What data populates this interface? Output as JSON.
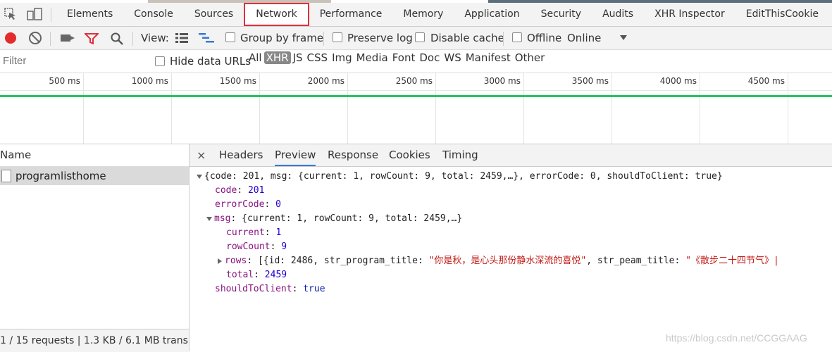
{
  "tabs": [
    "Elements",
    "Console",
    "Sources",
    "Network",
    "Performance",
    "Memory",
    "Application",
    "Security",
    "Audits",
    "XHR Inspector",
    "EditThisCookie"
  ],
  "active_tab": "Network",
  "toolbar": {
    "view_label": "View:",
    "group_by_frame": "Group by frame",
    "preserve_log": "Preserve log",
    "disable_cache": "Disable cache",
    "offline": "Offline",
    "throttle": "Online"
  },
  "filterbar": {
    "placeholder": "Filter",
    "hide_data_urls": "Hide data URLs",
    "types": [
      "All",
      "XHR",
      "JS",
      "CSS",
      "Img",
      "Media",
      "Font",
      "Doc",
      "WS",
      "Manifest",
      "Other"
    ],
    "selected_type": "XHR"
  },
  "timeline": {
    "ticks": [
      "500 ms",
      "1000 ms",
      "1500 ms",
      "2000 ms",
      "2500 ms",
      "3000 ms",
      "3500 ms",
      "4000 ms",
      "4500 ms"
    ]
  },
  "requests": {
    "header": "Name",
    "items": [
      "programlisthome"
    ],
    "status": "1 / 15 requests | 1.3 KB / 6.1 MB trans..."
  },
  "details": {
    "tabs": [
      "Headers",
      "Preview",
      "Response",
      "Cookies",
      "Timing"
    ],
    "active": "Preview",
    "close_glyph": "×"
  },
  "preview": {
    "root_summary": "{code: 201, msg: {current: 1, rowCount: 9, total: 2459,…}, errorCode: 0, shouldToClient: true}",
    "code_key": "code",
    "code_val": "201",
    "errorCode_key": "errorCode",
    "errorCode_val": "0",
    "msg_key": "msg",
    "msg_summary": "{current: 1, rowCount: 9, total: 2459,…}",
    "current_key": "current",
    "current_val": "1",
    "rowCount_key": "rowCount",
    "rowCount_val": "9",
    "rows_key": "rows",
    "rows_summary_a": "[{id: 2486, str_program_title: ",
    "rows_title": "\"你是秋，是心头那份静水深流的喜悦\"",
    "rows_summary_b": ", str_peam_title: ",
    "rows_peam": "\"《散步二十四节气》|",
    "total_key": "total",
    "total_val": "2459",
    "shouldToClient_key": "shouldToClient",
    "shouldToClient_val": "true"
  },
  "watermark": "https://blog.csdn.net/CCGGAAG",
  "colors": {
    "record": "#e32c2c",
    "active_tab_border": "#e0303a",
    "timeline_green": "#22c55e",
    "filter_selected": "#888888"
  }
}
